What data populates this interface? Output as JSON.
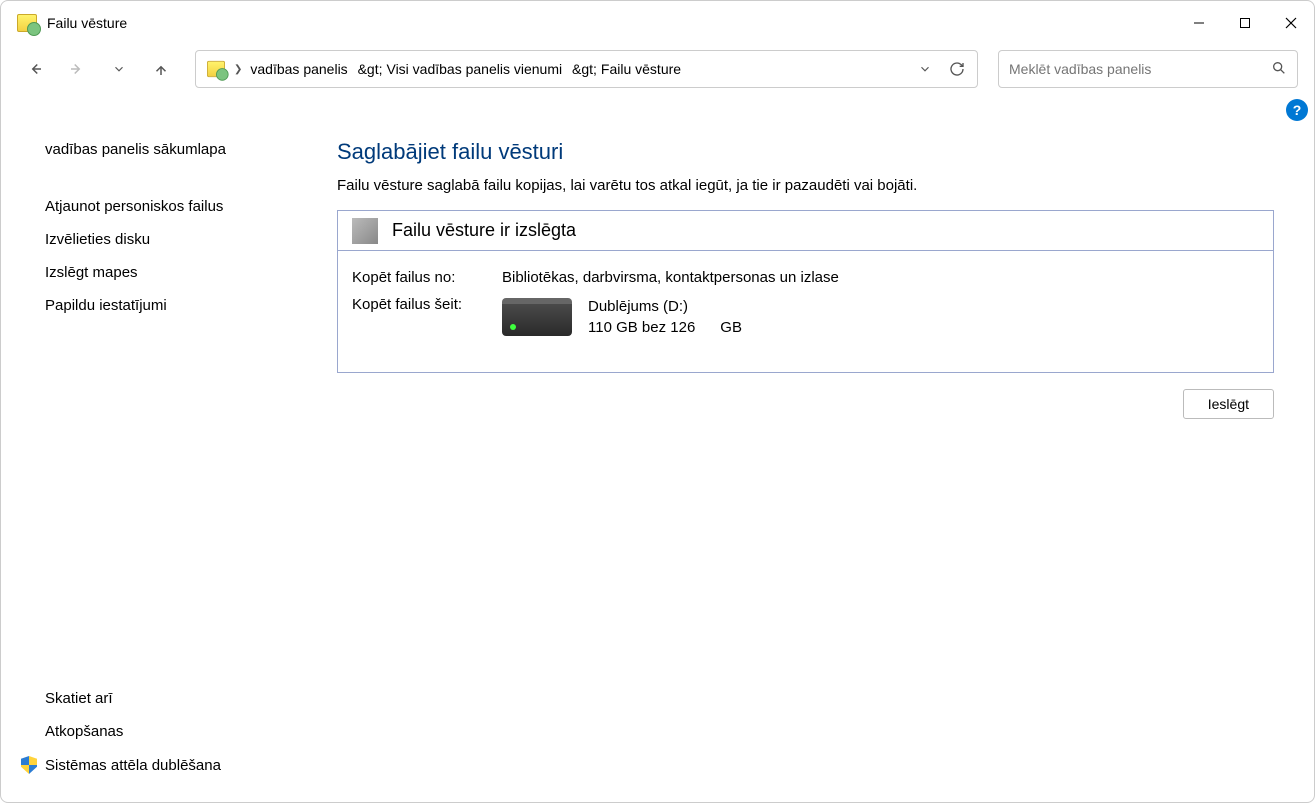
{
  "window": {
    "title": "Failu vēsture"
  },
  "breadcrumb": {
    "seg1": "vadības panelis",
    "seg2": "Visi vadības panelis vienumi",
    "seg3": "Failu vēsture",
    "gt": ">"
  },
  "search": {
    "placeholder": "Meklēt vadības panelis"
  },
  "sidebar": {
    "home": "vadības panelis sākumlapa",
    "restore": "Atjaunot personiskos failus",
    "select_drive": "Izvēlieties disku",
    "exclude": "Izslēgt mapes",
    "advanced": "Papildu iestatījumi",
    "see_also": "Skatiet arī",
    "recovery": "Atkopšanas",
    "sys_image": "Sistēmas attēla dublēšana"
  },
  "main": {
    "heading": "Saglabājiet failu vēsturi",
    "desc": "Failu vēsture saglabā failu kopijas, lai varētu tos atkal iegūt, ja tie ir pazaudēti vai bojāti.",
    "status_title": "Failu vēsture ir izslēgta",
    "copy_from_label": "Kopēt failus no:",
    "copy_from_value": "Bibliotēkas, darbvirsma, kontaktpersonas un izlase",
    "copy_to_label": "Kopēt failus šeit:",
    "drive_name": "Dublējums (D:)",
    "drive_space": "110 GB bez 126      GB",
    "enable_btn": "Ieslēgt"
  },
  "help": "?"
}
